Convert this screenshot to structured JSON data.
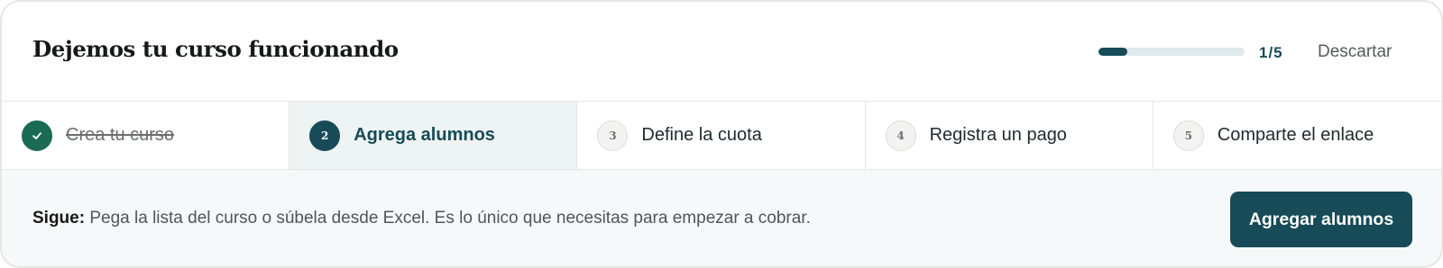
{
  "header": {
    "title": "Dejemos tu curso funcionando",
    "progress": {
      "fraction": 0.2,
      "label": "1/5"
    },
    "dismiss_label": "Descartar"
  },
  "steps": [
    {
      "number": "1",
      "label": "Crea tu curso",
      "state": "done",
      "icon": "check-icon"
    },
    {
      "number": "2",
      "label": "Agrega alumnos",
      "state": "current"
    },
    {
      "number": "3",
      "label": "Define la cuota",
      "state": "pending"
    },
    {
      "number": "4",
      "label": "Registra un pago",
      "state": "pending"
    },
    {
      "number": "5",
      "label": "Comparte el enlace",
      "state": "pending"
    }
  ],
  "footer": {
    "hint_prefix": "Sigue:",
    "hint_text": "Pega la lista del curso o súbela desde Excel. Es lo único que necesitas para empezar a cobrar.",
    "cta_label": "Agregar alumnos"
  },
  "colors": {
    "primary": "#164b57",
    "done": "#1b6b54",
    "current_step_bg": "#eef3f3",
    "footer_bg": "#f6f9fa"
  }
}
